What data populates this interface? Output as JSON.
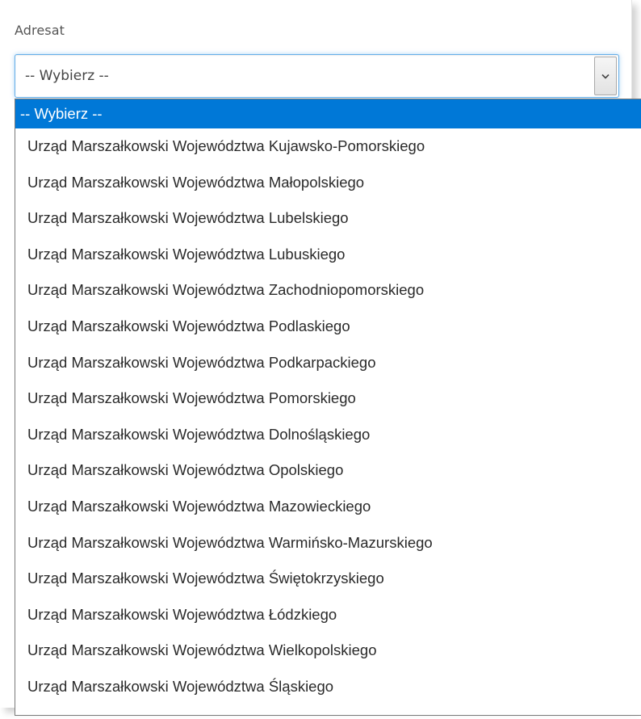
{
  "field": {
    "label": "Adresat",
    "selected_value": "-- Wybierz --"
  },
  "icons": {
    "dropdown": "chevron-down-icon"
  },
  "colors": {
    "focus_border": "#66afe9",
    "highlight": "#0078d7",
    "highlight_text": "#ffffff"
  },
  "options": [
    "-- Wybierz --",
    "Urząd Marszałkowski Województwa Kujawsko-Pomorskiego",
    "Urząd Marszałkowski Województwa Małopolskiego",
    "Urząd Marszałkowski Województwa Lubelskiego",
    "Urząd Marszałkowski Województwa Lubuskiego",
    "Urząd Marszałkowski Województwa Zachodniopomorskiego",
    "Urząd Marszałkowski Województwa Podlaskiego",
    "Urząd Marszałkowski Województwa Podkarpackiego",
    "Urząd Marszałkowski Województwa Pomorskiego",
    "Urząd Marszałkowski Województwa Dolnośląskiego",
    "Urząd Marszałkowski Województwa Opolskiego",
    "Urząd Marszałkowski Województwa Mazowieckiego",
    "Urząd Marszałkowski Województwa Warmińsko-Mazurskiego",
    "Urząd Marszałkowski Województwa Świętokrzyskiego",
    "Urząd Marszałkowski Województwa Łódzkiego",
    "Urząd Marszałkowski Województwa Wielkopolskiego",
    "Urząd Marszałkowski Województwa Śląskiego"
  ]
}
